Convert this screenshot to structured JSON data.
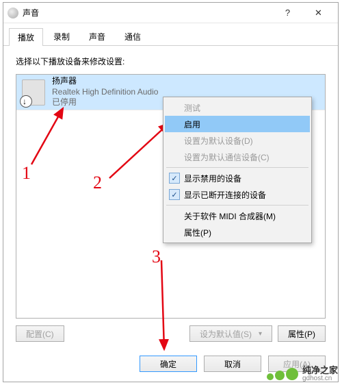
{
  "window": {
    "title": "声音",
    "close_glyph": "✕",
    "help_glyph": "?"
  },
  "tabs": [
    {
      "label": "播放",
      "active": true
    },
    {
      "label": "录制",
      "active": false
    },
    {
      "label": "声音",
      "active": false
    },
    {
      "label": "通信",
      "active": false
    }
  ],
  "instruction": "选择以下播放设备来修改设置:",
  "device": {
    "name": "扬声器",
    "driver": "Realtek High Definition Audio",
    "status": "已停用"
  },
  "context_menu": {
    "items": [
      {
        "label": "测试",
        "kind": "disabled"
      },
      {
        "label": "启用",
        "kind": "highlight"
      },
      {
        "label": "设置为默认设备(D)",
        "kind": "disabled"
      },
      {
        "label": "设置为默认通信设备(C)",
        "kind": "disabled"
      },
      {
        "sep": true
      },
      {
        "label": "显示禁用的设备",
        "kind": "checked"
      },
      {
        "label": "显示已断开连接的设备",
        "kind": "checked"
      },
      {
        "sep": true
      },
      {
        "label": "关于软件 MIDI 合成器(M)",
        "kind": "normal"
      },
      {
        "label": "属性(P)",
        "kind": "normal"
      }
    ]
  },
  "lower_buttons": {
    "configure": "配置(C)",
    "set_default": "设为默认值(S)",
    "properties": "属性(P)"
  },
  "footer": {
    "ok": "确定",
    "cancel": "取消",
    "apply": "应用(A)"
  },
  "annotations": {
    "n1": "1",
    "n2": "2",
    "n3": "3"
  },
  "watermark": {
    "cn": "纯净之家",
    "en": "gdhost.cn"
  }
}
